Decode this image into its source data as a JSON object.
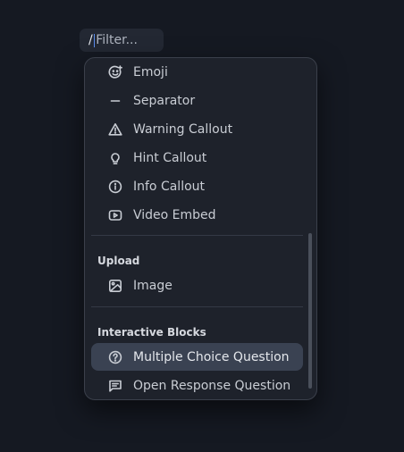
{
  "filter": {
    "slash": "/",
    "placeholder": "Filter..."
  },
  "menu": {
    "items_top": [
      {
        "label": "Emoji",
        "icon": "emoji-icon"
      },
      {
        "label": "Separator",
        "icon": "separator-icon"
      },
      {
        "label": "Warning Callout",
        "icon": "warning-icon"
      },
      {
        "label": "Hint Callout",
        "icon": "lightbulb-icon"
      },
      {
        "label": "Info Callout",
        "icon": "info-icon"
      },
      {
        "label": "Video Embed",
        "icon": "video-icon"
      }
    ],
    "upload_section": {
      "title": "Upload",
      "items": [
        {
          "label": "Image",
          "icon": "image-icon"
        }
      ]
    },
    "interactive_section": {
      "title": "Interactive Blocks",
      "items": [
        {
          "label": "Multiple Choice Question",
          "icon": "question-circle-icon",
          "active": true
        },
        {
          "label": "Open Response Question",
          "icon": "message-icon"
        }
      ]
    }
  },
  "colors": {
    "background": "#151922",
    "menu_bg": "#1e222b",
    "active_bg": "#3a4252",
    "caret": "#5b8def"
  }
}
